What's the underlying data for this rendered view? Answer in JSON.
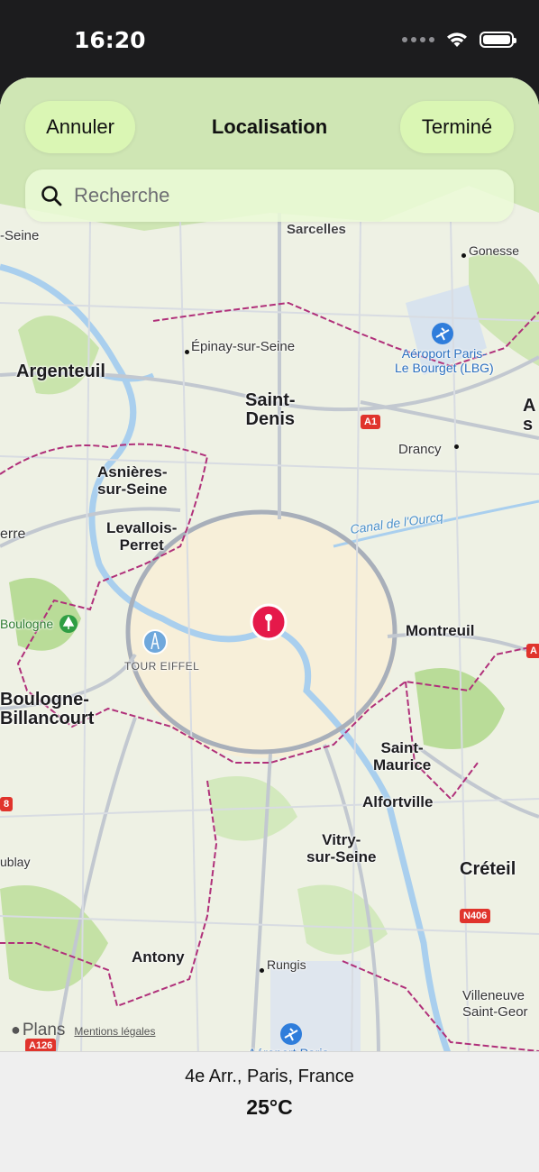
{
  "status_bar": {
    "time": "16:20",
    "icons": [
      "cellular-dots-icon",
      "wifi-icon",
      "battery-icon"
    ]
  },
  "nav": {
    "cancel_label": "Annuler",
    "title": "Localisation",
    "done_label": "Terminé"
  },
  "search": {
    "placeholder": "Recherche"
  },
  "map": {
    "labels": {
      "seine_nw": "-Seine",
      "sarcelles": "Sarcelles",
      "gonesse": "Gonesse",
      "epinay": "Épinay-sur-Seine",
      "aeroport": "Aéroport Paris-\nLe Bourget (LBG)",
      "argenteuil": "Argenteuil",
      "saint_denis": "Saint-\nDenis",
      "a_east": "A\ns",
      "drancy": "Drancy",
      "asnieres": "Asnières-\nsur-Seine",
      "levallois": "Levallois-\nPerret",
      "canal": "Canal de l'Ourcq",
      "erre": "erre",
      "bois_boulogne": "Boulogne",
      "tour_eiffel": "TOUR EIFFEL",
      "montreuil": "Montreuil",
      "boulogne_billancourt": "Boulogne-\nBillancourt",
      "saint_maurice": "Saint-\nMaurice",
      "alfortville": "Alfortville",
      "ublay": "ublay",
      "vitry": "Vitry-\nsur-Seine",
      "creteil": "Créteil",
      "antony": "Antony",
      "rungis": "Rungis",
      "villeneuve": "Villeneuve\nSaint-Geor",
      "aeroport_orly": "Aéroport Paris-"
    },
    "road_shields": [
      "A1",
      "N406",
      "A126",
      "A",
      "A",
      "8"
    ]
  },
  "attribution": {
    "brand": "Plans",
    "legal": "Mentions légales"
  },
  "footer": {
    "location": "4e Arr., Paris, France",
    "temperature": "25°C"
  },
  "colors": {
    "accent_button": "#dcf8b4",
    "pin": "#e5194a",
    "boundary": "#b0307a"
  }
}
